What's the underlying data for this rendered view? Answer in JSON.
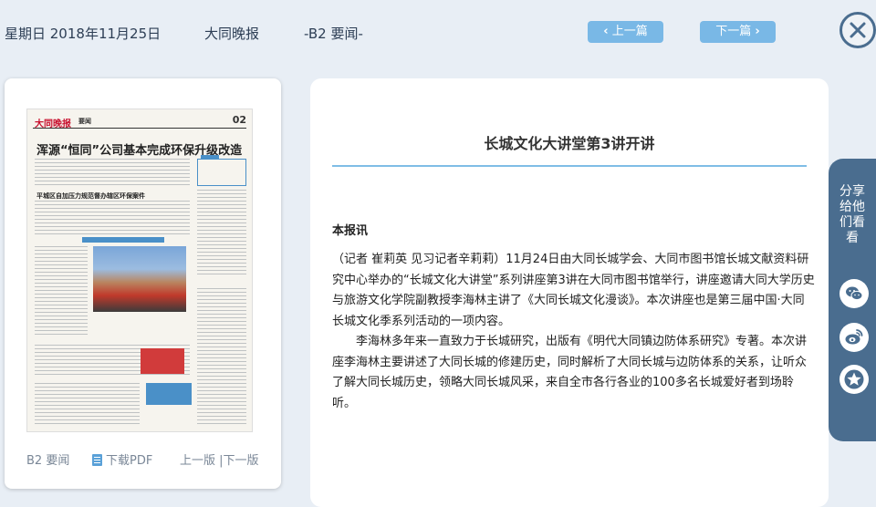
{
  "header": {
    "date": "星期日 2018年11月25日",
    "paper_name": "大同晚报",
    "page": "-B2 要闻-",
    "prev_label": "上一篇",
    "next_label": "下一篇"
  },
  "thumbnail": {
    "masthead": "大同晚报",
    "section": "要闻",
    "page_no": "02",
    "headline": "浑源“恒同”公司基本完成环保升级改造",
    "sub_headline": "平城区自加压力规范督办辖区环保案件",
    "footer": {
      "page_label": "B2 要闻",
      "pdf_label": "下载PDF",
      "page_nav": "上一版 |下一版"
    }
  },
  "article": {
    "title": "长城文化大讲堂第3讲开讲",
    "byline": "本报讯",
    "paragraphs": [
      "（记者 崔莉英 见习记者辛莉莉）11月24日由大同长城学会、大同市图书馆长城文献资料研究中心举办的“长城文化大讲堂”系列讲座第3讲在大同市图书馆举行，讲座邀请大同大学历史与旅游文化学院副教授李海林主讲了《大同长城文化漫谈》。本次讲座也是第三届中国·大同长城文化季系列活动的一项内容。",
      "李海林多年来一直致力于长城研究，出版有《明代大同镇边防体系研究》专著。本次讲座李海林主要讲述了大同长城的修建历史，同时解析了大同长城与边防体系的关系，让听众了解大同长城历史，领略大同长城风采，来自全市各行各业的100多名长城爱好者到场聆听。"
    ]
  },
  "share": {
    "label": "分享给他们看看",
    "icons": [
      "wechat-icon",
      "weibo-icon",
      "star-icon"
    ]
  },
  "colors": {
    "background": "#e8eef5",
    "nav_button": "#79b8e6",
    "share_panel": "#4a6d8f",
    "title_rule": "#7fbde6"
  }
}
